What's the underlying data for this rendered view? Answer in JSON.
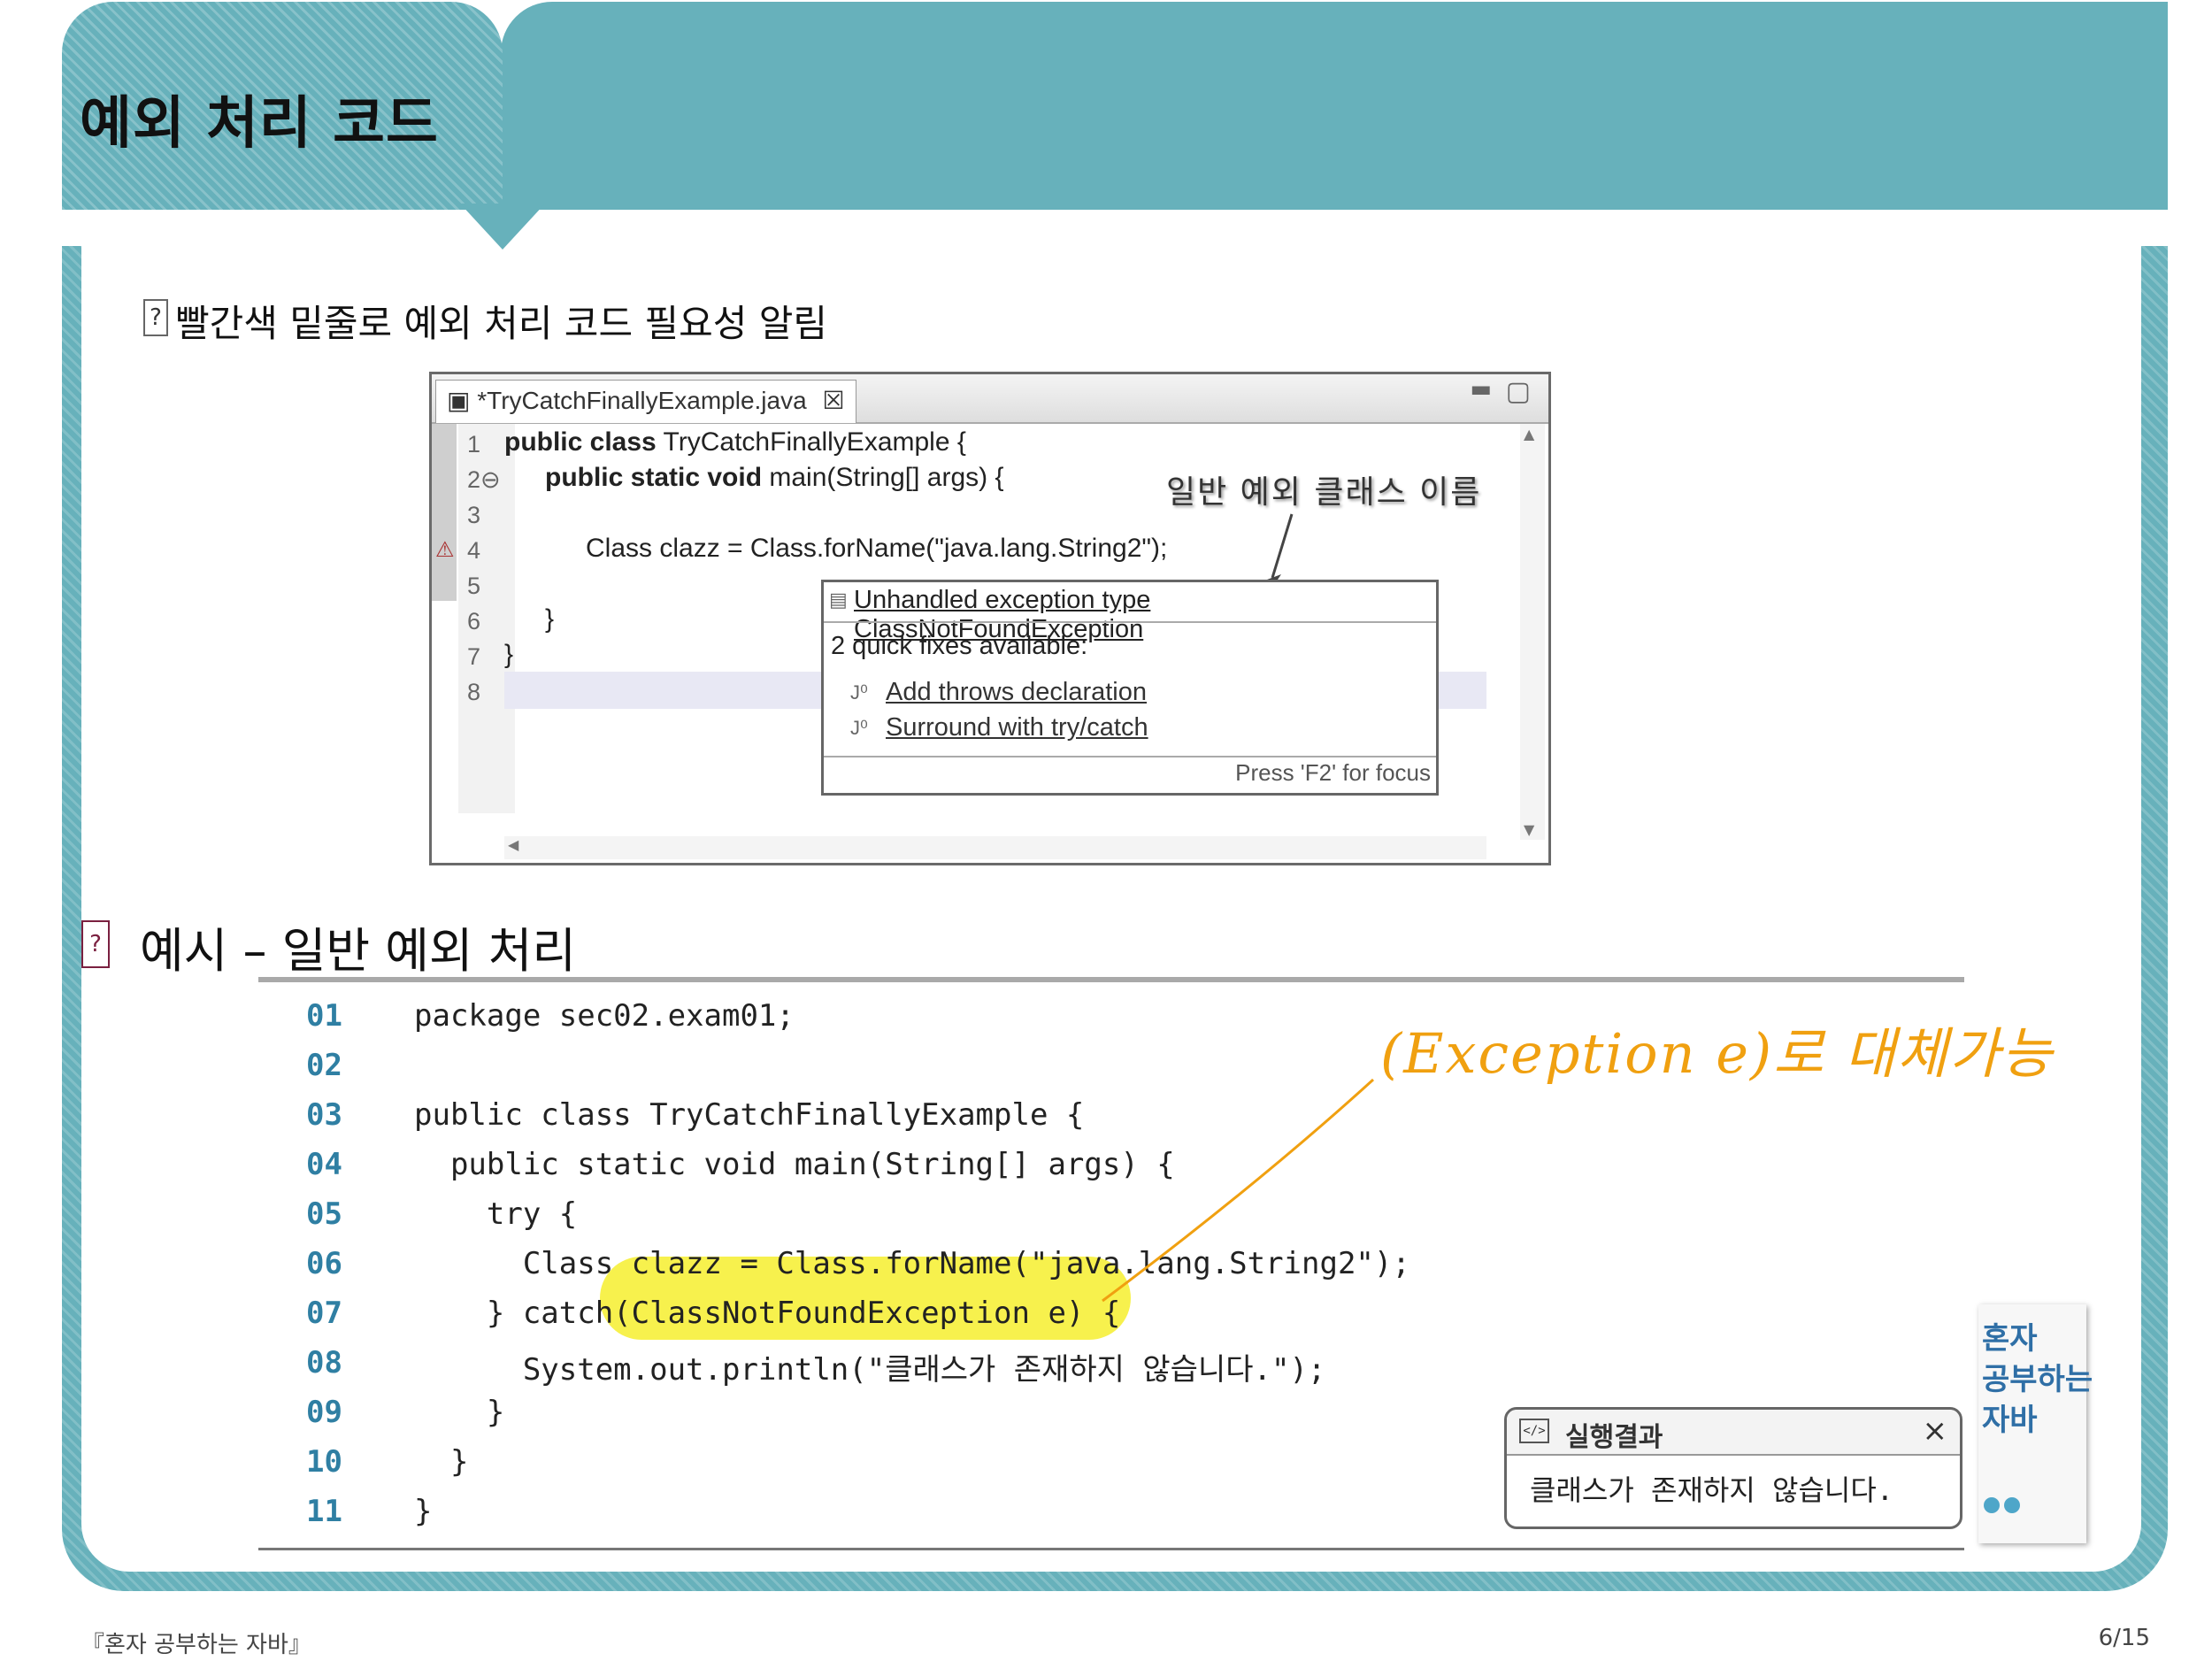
{
  "slide": {
    "title": "예외 처리 코드",
    "note_bullet": "?",
    "note": "빨간색 밑줄로 예외 처리 코드 필요성 알림"
  },
  "ide": {
    "tab_label": "*TryCatchFinallyExample.java",
    "tab_close": "☒",
    "line_numbers": [
      "1",
      "2⊖",
      "3",
      "4",
      "5",
      "6",
      "7",
      "8"
    ],
    "code": {
      "line1_kw": "public class",
      "line1_rest": " TryCatchFinallyExample {",
      "line2_kw": "public static void",
      "line2_rest": " main(String[] args) {",
      "line4": "Class clazz = Class.forName(\"java.lang.String2\");",
      "line6": "}",
      "line7": "}"
    },
    "callout": "일반 예외 클래스 이름",
    "popup": {
      "header": "Unhandled exception type ClassNotFoundException",
      "fixes_title": "2 quick fixes available:",
      "fixes": [
        "Add throws declaration",
        "Surround with try/catch"
      ],
      "footer": "Press 'F2' for focus"
    }
  },
  "example": {
    "bullet": "?",
    "heading": "예시 – 일반 예외 처리",
    "line_numbers": [
      "01",
      "02",
      "03",
      "04",
      "05",
      "06",
      "07",
      "08",
      "09",
      "10",
      "11"
    ],
    "lines": [
      "package sec02.exam01;",
      "",
      "public class TryCatchFinallyExample {",
      "  public static void main(String[] args) {",
      "    try {",
      "      Class clazz = Class.forName(\"java.lang.String2\");",
      "    } catch(ClassNotFoundException e) {",
      "      System.out.println(\"클래스가 존재하지 않습니다.\");",
      "    }",
      "  }",
      "}"
    ],
    "annotation": "(Exception e)로 대체가능",
    "highlight_color": "#f6f03a",
    "annotation_color": "#f0a010"
  },
  "result": {
    "title": "실행결과",
    "close": "×",
    "output": "클래스가 존재하지 않습니다."
  },
  "book": {
    "cover_title": "혼자 공부하는 자바"
  },
  "footer": {
    "book_ref": "『혼자 공부하는 자바』",
    "page": "6/15"
  },
  "colors": {
    "accent": "#67b1bb",
    "line_number": "#2f7fa3"
  }
}
